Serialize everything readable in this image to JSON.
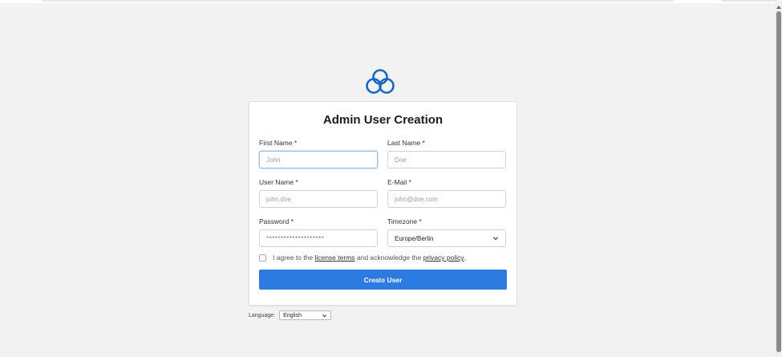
{
  "form": {
    "title": "Admin User Creation",
    "first_name": {
      "label": "First Name *",
      "placeholder": "John"
    },
    "last_name": {
      "label": "Last Name *",
      "placeholder": "Doe"
    },
    "user_name": {
      "label": "User Name *",
      "placeholder": "john.doe"
    },
    "email": {
      "label": "E-Mail *",
      "placeholder": "john@doe.com"
    },
    "password": {
      "label": "Password *",
      "value": "********************"
    },
    "timezone": {
      "label": "Timezone *",
      "value": "Europe/Berlin"
    },
    "agree": {
      "prefix": "I agree to the ",
      "license_link": "license terms",
      "middle": " and acknowledge the ",
      "privacy_link": "privacy policy",
      "suffix": "."
    },
    "submit_label": "Create User"
  },
  "language": {
    "label": "Language:",
    "value": "English"
  },
  "colors": {
    "accent": "#2c7be0",
    "logo": "#1a66c4",
    "background": "#f2f2f2"
  },
  "icons": {
    "logo": "cloud-logo-icon",
    "dropdown": "chevron-down-icon"
  }
}
